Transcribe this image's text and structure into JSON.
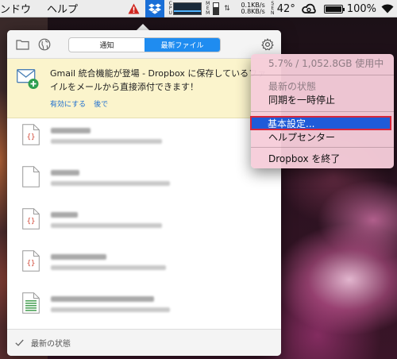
{
  "menubar": {
    "items": [
      "ンドウ",
      "ヘルプ"
    ],
    "status": {
      "cpu_label": [
        "C",
        "P",
        "U"
      ],
      "mem_label": [
        "M",
        "E",
        "M"
      ],
      "mem_level": 0.65,
      "net_up": "0.1KB/s",
      "net_down": "0.8KB/s",
      "sensor_label": [
        "S",
        "E",
        "N"
      ],
      "temperature": "42°",
      "battery_level": 1.0,
      "battery_percent": "100%"
    }
  },
  "popup": {
    "tabs": [
      {
        "label": "通知",
        "active": false
      },
      {
        "label": "最新ファイル",
        "active": true
      }
    ],
    "banner": {
      "message_line1": "Gmail 統合機能が登場 - Dropbox に保存しているファ",
      "message_line2": "イルをメールから直接添付できます！",
      "enable_link": "有効にする",
      "later_link": "後で"
    },
    "files": [
      {
        "icon": "code-file-icon"
      },
      {
        "icon": "document-file-icon"
      },
      {
        "icon": "code-file-icon"
      },
      {
        "icon": "code-file-icon"
      },
      {
        "icon": "spreadsheet-file-icon"
      }
    ],
    "footer_status": "最新の状態"
  },
  "context_menu": {
    "usage": "5.7% / 1,052.8GB 使用中",
    "sync_status": "最新の状態",
    "pause_sync": "同期を一時停止",
    "preferences": "基本設定...",
    "help_center": "ヘルプセンター",
    "quit": "Dropbox を終了"
  },
  "colors": {
    "dropbox_blue": "#1a6fd7",
    "tab_active": "#1f8cf0",
    "banner_bg": "#fbf4cc",
    "highlight": "#1f5bd8",
    "highlight_border": "#d6273c"
  }
}
